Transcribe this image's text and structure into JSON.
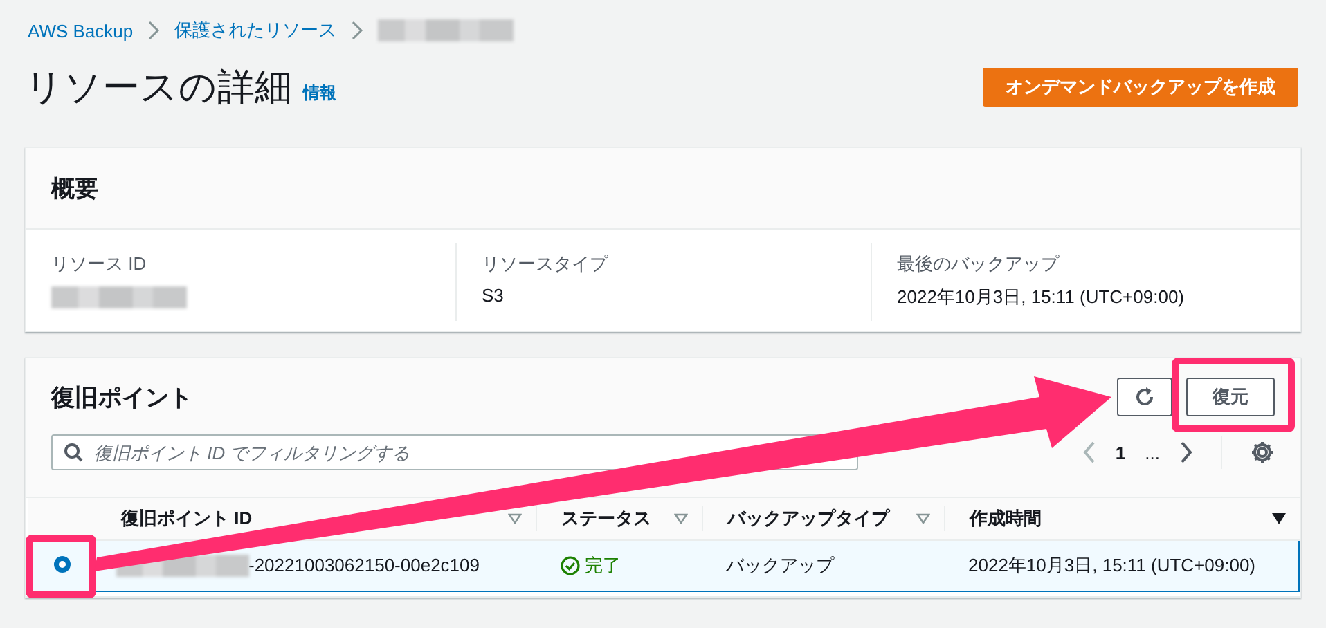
{
  "breadcrumb": [
    {
      "kind": "link",
      "label": "AWS Backup"
    },
    {
      "kind": "link",
      "label": "保護されたリソース"
    },
    {
      "kind": "redacted"
    }
  ],
  "page": {
    "title": "リソースの詳細",
    "info_link": "情報",
    "primary_button": "オンデマンドバックアップを作成"
  },
  "overview": {
    "title": "概要",
    "fields": [
      {
        "label": "リソース ID",
        "kind": "redacted"
      },
      {
        "label": "リソースタイプ",
        "kind": "text",
        "value": "S3"
      },
      {
        "label": "最後のバックアップ",
        "kind": "text",
        "value": "2022年10月3日, 15:11 (UTC+09:00)"
      }
    ]
  },
  "recovery_points": {
    "title": "復旧ポイント",
    "restore_button": "復元",
    "search": {
      "placeholder": "復旧ポイント ID でフィルタリングする"
    },
    "pagination": {
      "current_page": "1",
      "ellipsis": "..."
    },
    "table": {
      "columns": [
        {
          "label": "復旧ポイント ID",
          "sorted": false
        },
        {
          "label": "ステータス",
          "sorted": false
        },
        {
          "label": "バックアップタイプ",
          "sorted": false
        },
        {
          "label": "作成時間",
          "sorted": true
        }
      ],
      "rows": [
        {
          "selected": true,
          "id_suffix": "-20221003062150-00e2c109",
          "status": "完了",
          "backup_type": "バックアップ",
          "created": "2022年10月3日, 15:11 (UTC+09:00)"
        }
      ]
    }
  }
}
